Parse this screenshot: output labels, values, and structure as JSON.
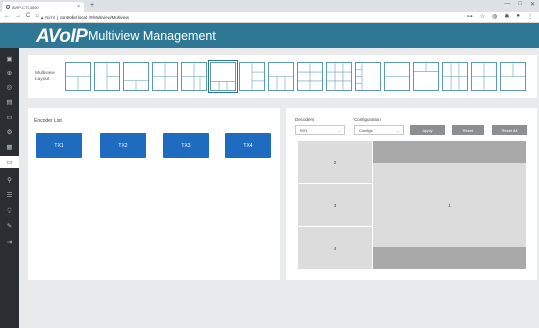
{
  "browser": {
    "tab_title": "AVIP-CTL3000",
    "tab_close": "×",
    "new_tab": "+",
    "window_controls": [
      "—",
      "□",
      "✕"
    ],
    "nav_buttons": [
      "←",
      "→",
      "C",
      "⌂"
    ],
    "security_label": "▲ Nicht",
    "url_host": "controller.local",
    "url_path": "/#/Multiview/Multiview",
    "ext_icons": [
      "⊶",
      "☆",
      "◍",
      "✱",
      "●",
      "⋮"
    ]
  },
  "header": {
    "logo": "AVoIP",
    "title": "Multiview Management"
  },
  "sidebar": {
    "items": [
      {
        "icon": "▣"
      },
      {
        "icon": "⊕"
      },
      {
        "icon": "◎"
      },
      {
        "icon": "▤"
      },
      {
        "icon": "▭"
      },
      {
        "icon": "⚙"
      },
      {
        "icon": "▦"
      },
      {
        "icon": "▭"
      },
      {
        "icon": "⚲"
      },
      {
        "icon": "☰"
      },
      {
        "icon": "⍜"
      },
      {
        "icon": "✎"
      },
      {
        "icon": "⇥"
      }
    ]
  },
  "layout": {
    "label": "Multiview Layout"
  },
  "encoder": {
    "title": "Encoder List",
    "items": [
      "TX1",
      "TX2",
      "TX3",
      "TX4"
    ]
  },
  "decoder": {
    "decoders_label": "Decoders",
    "decoder_value": "RX1",
    "configuration_label": "Configuration",
    "configuration_value": "Configs",
    "apply_label": "Apply",
    "reset_label": "Reset",
    "reset_all_label": "Reset All",
    "cells": [
      "2",
      "3",
      "4",
      "1"
    ]
  },
  "colors": {
    "brand": "#2e7896",
    "tx_button": "#1f6bbf",
    "sidebar": "#2a2d31"
  }
}
